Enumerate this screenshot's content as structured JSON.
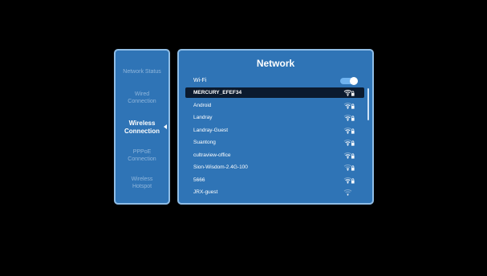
{
  "sidebar": {
    "items": [
      {
        "label": "Network Status",
        "active": false
      },
      {
        "label": "Wired Connection",
        "active": false
      },
      {
        "label": "Wireless Connection",
        "active": true
      },
      {
        "label": "PPPoE Connection",
        "active": false
      },
      {
        "label": "Wireless Hotspot",
        "active": false
      }
    ]
  },
  "panel": {
    "title": "Network",
    "wifi_label": "Wi-Fi",
    "wifi_enabled": true
  },
  "networks": [
    {
      "name": "MERCURY_EFEF34",
      "selected": true,
      "signal": 4,
      "locked": true
    },
    {
      "name": "Android",
      "selected": false,
      "signal": 3,
      "locked": true
    },
    {
      "name": "Landray",
      "selected": false,
      "signal": 3,
      "locked": true
    },
    {
      "name": "Landray-Guest",
      "selected": false,
      "signal": 3,
      "locked": true
    },
    {
      "name": "Suantong",
      "selected": false,
      "signal": 3,
      "locked": true
    },
    {
      "name": "cultraview-office",
      "selected": false,
      "signal": 3,
      "locked": true
    },
    {
      "name": "Sion-Wisdom-2.4G-100",
      "selected": false,
      "signal": 2,
      "locked": true
    },
    {
      "name": "5666",
      "selected": false,
      "signal": 3,
      "locked": true
    },
    {
      "name": "JRX-guest",
      "selected": false,
      "signal": 1,
      "locked": false
    }
  ],
  "colors": {
    "panel_bg": "#2f74b6",
    "selected_bg": "#0b1a2e",
    "accent": "#6fb3f0"
  },
  "icons": {
    "wifi_signal": "wifi-signal-icon",
    "lock": "lock-icon",
    "caret": "caret-left-icon"
  }
}
